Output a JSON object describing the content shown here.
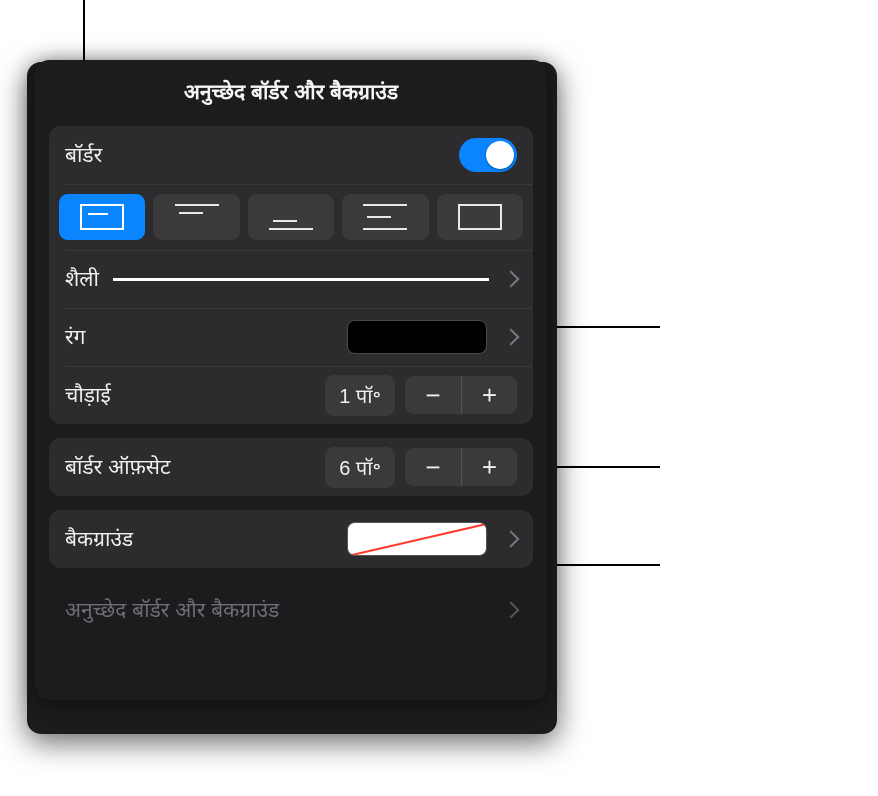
{
  "panel": {
    "title": "अनुच्छेद बॉर्डर और बैकग्राउंड"
  },
  "border": {
    "label": "बॉर्डर",
    "enabled": true
  },
  "style": {
    "label": "शैली"
  },
  "color": {
    "label": "रंग",
    "value": "#000000"
  },
  "width": {
    "label": "चौड़ाई",
    "value": "1 पॉ॰",
    "minus": "−",
    "plus": "+"
  },
  "offset": {
    "label": "बॉर्डर ऑफ़सेट",
    "value": "6 पॉ॰",
    "minus": "−",
    "plus": "+"
  },
  "background": {
    "label": "बैकग्राउंड"
  },
  "peek": {
    "label": "अनुच्छेद बॉर्डर और बैकग्राउंड"
  }
}
